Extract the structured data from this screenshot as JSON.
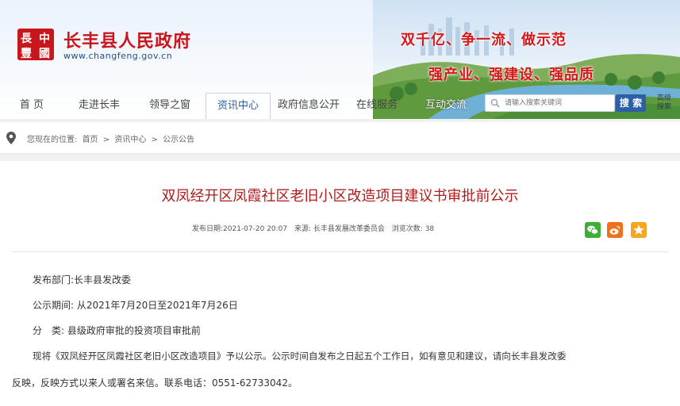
{
  "header": {
    "emblem_text": [
      "長",
      "中",
      "豐",
      "國"
    ],
    "site_title": "长丰县人民政府",
    "site_url": "www.changfeng.gov.cn",
    "slogan_line1": "双千亿、争一流、做示范",
    "slogan_line2": "强产业、强建设、强品质"
  },
  "nav": {
    "items": [
      {
        "label": "首 页"
      },
      {
        "label": "走进长丰"
      },
      {
        "label": "领导之窗"
      },
      {
        "label": "资讯中心",
        "active": true
      },
      {
        "label": "政府信息公开"
      },
      {
        "label": "在线服务"
      },
      {
        "label": "互动交流"
      }
    ]
  },
  "search": {
    "placeholder": "请输入搜索关键词",
    "button_label": "搜 索",
    "advanced_line1": "高级",
    "advanced_line2": "搜索"
  },
  "breadcrumb": {
    "prefix": "您现在的位置:",
    "items": [
      "首页",
      ">",
      "资讯中心",
      ">",
      "公示公告"
    ]
  },
  "article": {
    "title": "双凤经开区凤霞社区老旧小区改造项目建议书审批前公示",
    "meta": {
      "date": "发布日期:2021-07-20 20:07",
      "source": "来源: 长丰县发展改革委员会",
      "views": "浏览次数: 38"
    },
    "share_icons": [
      "wechat-icon",
      "weibo-icon",
      "favorite-icon"
    ],
    "body": [
      "发布部门:长丰县发改委",
      "公示期间: 从2021年7月20日至2021年7月26日",
      "分　类: 县级政府审批的投资项目审批前",
      "现将《双凤经开区凤霞社区老旧小区改造项目》予以公示。公示时间自发布之日起五个工作日，如有意见和建议，请向长丰县发改委",
      "反映，反映方式以来人或署名来信。联系电话：0551-62733042。"
    ]
  },
  "colors": {
    "title_red": "#b31b1b",
    "brand_red": "#c8161d",
    "nav_blue": "#2a5fa8",
    "search_button": "#2c5fa6",
    "wechat": "#3cb034",
    "weibo": "#f0701c",
    "favorite": "#f5a623"
  }
}
